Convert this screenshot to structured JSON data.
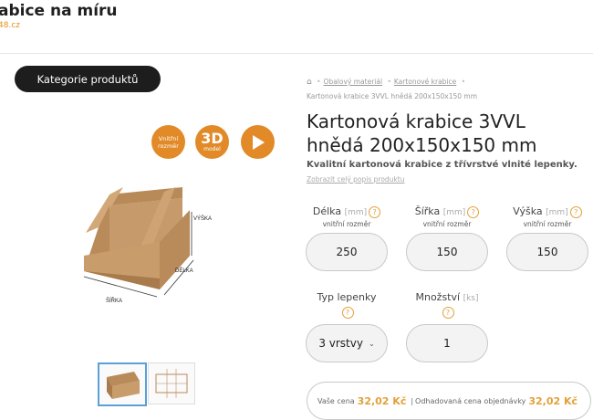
{
  "header": {
    "site_title": "abice na míru",
    "site_sub": "48.cz"
  },
  "sidebar": {
    "category_button": "Kategorie produktů"
  },
  "badges": {
    "inner_size": "Vnitřní rozměr",
    "model_big": "3D",
    "model_small": "model"
  },
  "image_labels": {
    "height": "VÝŠKA",
    "length": "DÉLKA",
    "width": "ŠÍŘKA"
  },
  "breadcrumb": {
    "items": [
      "Obalový materiál",
      "Kartonové krabice"
    ],
    "current": "Kartonová krabice 3VVL hnědá 200x150x150 mm"
  },
  "product": {
    "title": "Kartonová krabice 3VVL hnědá 200x150x150 mm",
    "description": "Kvalitní kartonová krabice z třívrstvé vlnité lepenky.",
    "full_desc_link": "Zobrazit celý popis produktu"
  },
  "dimensions": {
    "length": {
      "label": "Délka",
      "unit": "[mm]",
      "sub": "vnitřní rozměr",
      "value": "250"
    },
    "width": {
      "label": "Šířka",
      "unit": "[mm]",
      "sub": "vnitřní rozměr",
      "value": "150"
    },
    "height": {
      "label": "Výška",
      "unit": "[mm]",
      "sub": "vnitřní rozměr",
      "value": "150"
    }
  },
  "options": {
    "board_type": {
      "label": "Typ lepenky",
      "value": "3 vrstvy"
    },
    "quantity": {
      "label": "Množství",
      "unit": "[ks]",
      "value": "1"
    }
  },
  "price": {
    "your_price_label": "Vaše cena",
    "your_price": "32,02 Kč",
    "estimated_label": "Odhadovaná cena objednávky",
    "estimated_price": "32,02 Kč"
  },
  "colors": {
    "accent": "#e28a27",
    "dark": "#1d1d1d"
  }
}
